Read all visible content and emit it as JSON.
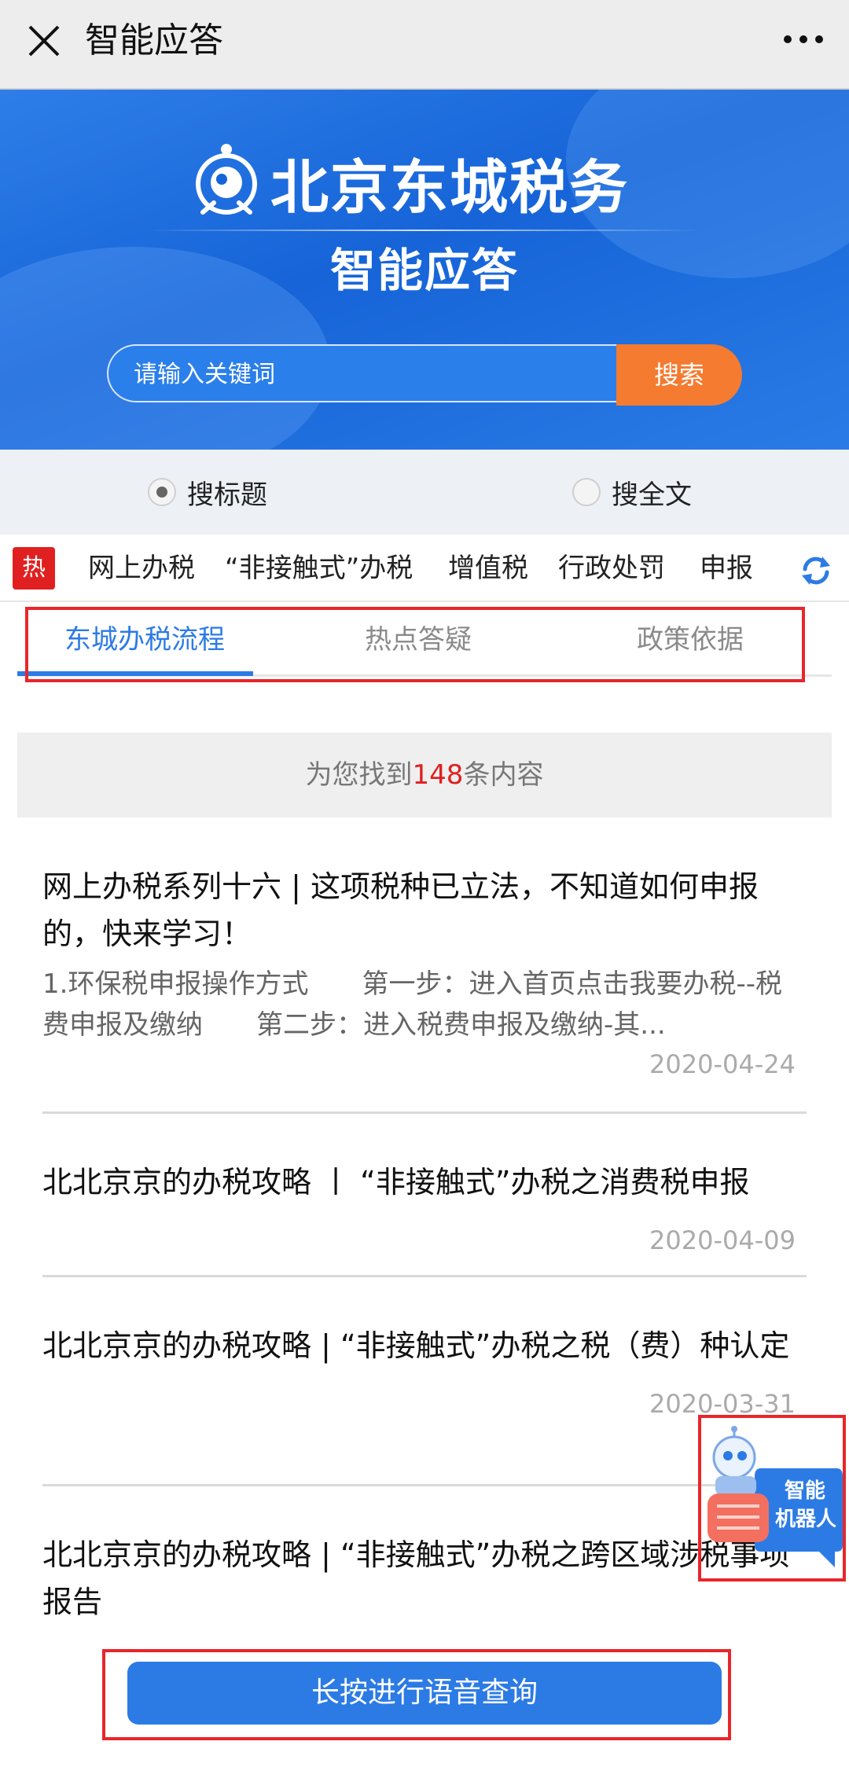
{
  "topbar": {
    "title": "智能应答"
  },
  "banner": {
    "brand": "北京东城税务",
    "subtitle": "智能应答",
    "search_placeholder": "请输入关键词",
    "search_button": "搜索"
  },
  "search_mode": {
    "options": [
      {
        "label": "搜标题",
        "selected": true
      },
      {
        "label": "搜全文",
        "selected": false
      }
    ]
  },
  "hot": {
    "badge": "热",
    "tags": [
      "网上办税",
      "“非接触式”办税",
      "增值税",
      "行政处罚",
      "申报"
    ]
  },
  "tabs": [
    {
      "label": "东城办税流程",
      "active": true
    },
    {
      "label": "热点答疑",
      "active": false
    },
    {
      "label": "政策依据",
      "active": false
    }
  ],
  "results": {
    "prefix": "为您找到",
    "count": "148",
    "suffix": "条内容"
  },
  "articles": [
    {
      "title": "网上办税系列十六 | 这项税种已立法，不知道如何申报的，快来学习！",
      "summary": "1.环保税申报操作方式　　第一步：进入首页点击我要办税--税费申报及缴纳　　第二步：进入税费申报及缴纳-其...",
      "date": "2020-04-24"
    },
    {
      "title": "北北京京的办税攻略 丨 “非接触式”办税之消费税申报",
      "summary": "",
      "date": "2020-04-09"
    },
    {
      "title": "北北京京的办税攻略 | “非接触式”办税之税（费）种认定",
      "summary": "",
      "date": "2020-03-31"
    },
    {
      "title": "北北京京的办税攻略 | “非接触式”办税之跨区域涉税事项报告",
      "summary": "",
      "date": ""
    }
  ],
  "robot": {
    "label_line1": "智能",
    "label_line2": "机器人"
  },
  "voice": {
    "label": "长按进行语音查询"
  },
  "colors": {
    "accent": "#2c7be5",
    "search_btn": "#f47b30",
    "hot": "#e02020",
    "highlight": "#e8262b"
  }
}
